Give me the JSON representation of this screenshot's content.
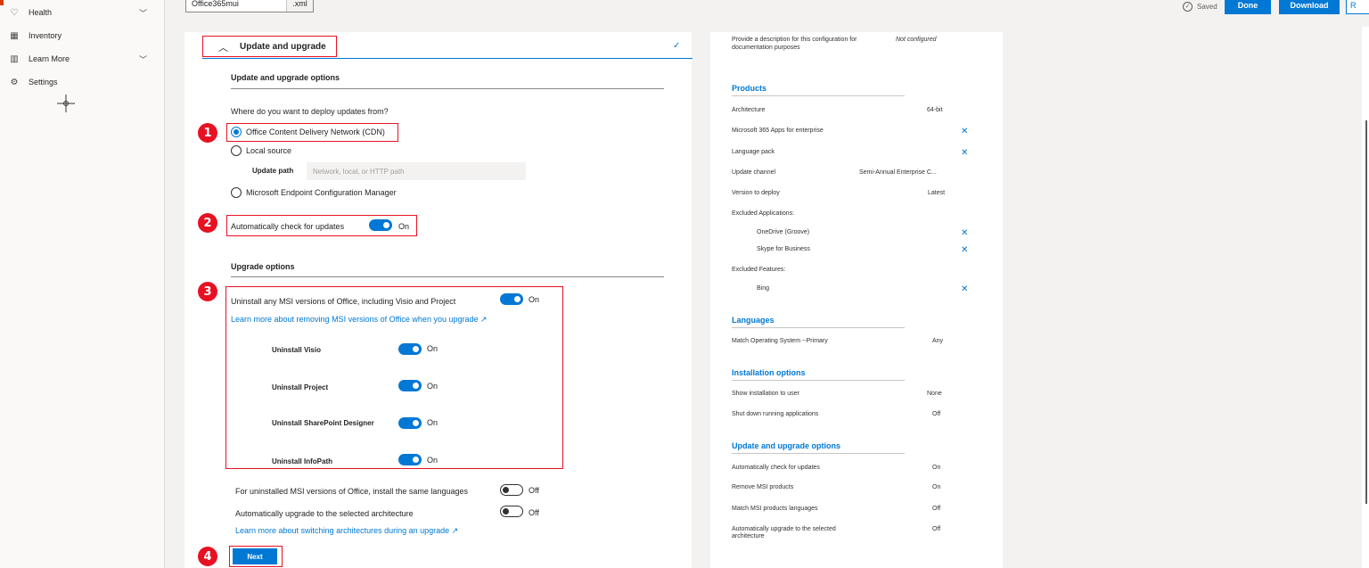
{
  "nav": {
    "items": [
      {
        "icon": "heart-icon",
        "glyph": "♡",
        "label": "Health",
        "chevron": true
      },
      {
        "icon": "grid-icon",
        "glyph": "▦",
        "label": "Inventory",
        "chevron": false
      },
      {
        "icon": "book-icon",
        "glyph": "▥",
        "label": "Learn More",
        "chevron": true
      },
      {
        "icon": "gear-icon",
        "glyph": "⚙",
        "label": "Settings",
        "chevron": false
      }
    ]
  },
  "topbar": {
    "filename": "Office365mui",
    "extension": ".xml",
    "saved_label": "Saved",
    "done_label": "Done",
    "download_label": "Download",
    "edge_label": "R"
  },
  "main": {
    "accordion_title": "Update and upgrade",
    "update_section_title": "Update and upgrade options",
    "deploy_question": "Where do you want to deploy updates from?",
    "source_options": [
      {
        "label": "Office Content Delivery Network (CDN)",
        "selected": true
      },
      {
        "label": "Local source",
        "selected": false
      },
      {
        "label": "Microsoft Endpoint Configuration Manager",
        "selected": false
      }
    ],
    "update_path_label": "Update path",
    "update_path_placeholder": "Network, local, or HTTP path",
    "auto_check_label": "Automatically check for updates",
    "auto_check_state": "On",
    "upgrade_section_title": "Upgrade options",
    "uninstall_msi_label": "Uninstall any MSI versions of Office, including Visio and Project",
    "uninstall_msi_state": "On",
    "learn_msi_link": "Learn more about removing MSI versions of Office when you upgrade",
    "uninstall_items": [
      {
        "label": "Uninstall Visio",
        "state": "On"
      },
      {
        "label": "Uninstall Project",
        "state": "On"
      },
      {
        "label": "Uninstall SharePoint Designer",
        "state": "On"
      },
      {
        "label": "Uninstall InfoPath",
        "state": "On"
      }
    ],
    "same_languages_label": "For uninstalled MSI versions of Office, install the same languages",
    "same_languages_state": "Off",
    "auto_upgrade_arch_label": "Automatically upgrade to the selected architecture",
    "auto_upgrade_arch_state": "Off",
    "learn_arch_link": "Learn more about switching architectures during an upgrade",
    "next_label": "Next",
    "badges": [
      "1",
      "2",
      "3",
      "4"
    ]
  },
  "summary": {
    "description_label": "Provide a description for this configuration for documentation purposes",
    "description_value": "Not configured",
    "products_title": "Products",
    "products": [
      {
        "label": "Architecture",
        "value": "64-bit"
      },
      {
        "label": "Microsoft 365 Apps for enterprise",
        "value": "",
        "removable": true
      },
      {
        "label": "Language pack",
        "value": "",
        "removable": true
      },
      {
        "label": "Update channel",
        "value": "Semi-Annual Enterprise C..."
      },
      {
        "label": "Version to deploy",
        "value": "Latest"
      },
      {
        "label": "Excluded Applications:",
        "value": ""
      },
      {
        "label": "OneDrive (Groove)",
        "value": "",
        "removable": true,
        "indent": true
      },
      {
        "label": "Skype for Business",
        "value": "",
        "removable": true,
        "indent": true
      },
      {
        "label": "Excluded Features:",
        "value": ""
      },
      {
        "label": "Bing",
        "value": "",
        "removable": true,
        "indent": true
      }
    ],
    "languages_title": "Languages",
    "languages": [
      {
        "label": "Match Operating System --Primary",
        "value": "Any"
      }
    ],
    "install_title": "Installation options",
    "install": [
      {
        "label": "Show installation to user",
        "value": "None"
      },
      {
        "label": "Shut down running applications",
        "value": "Off"
      }
    ],
    "update_title": "Update and upgrade options",
    "update": [
      {
        "label": "Automatically check for updates",
        "value": "On"
      },
      {
        "label": "Remove MSI products",
        "value": "On"
      },
      {
        "label": "Match MSI products languages",
        "value": "Off"
      },
      {
        "label": "Automatically upgrade to the selected architecture",
        "value": "Off"
      }
    ],
    "remove_glyph": "✕"
  }
}
